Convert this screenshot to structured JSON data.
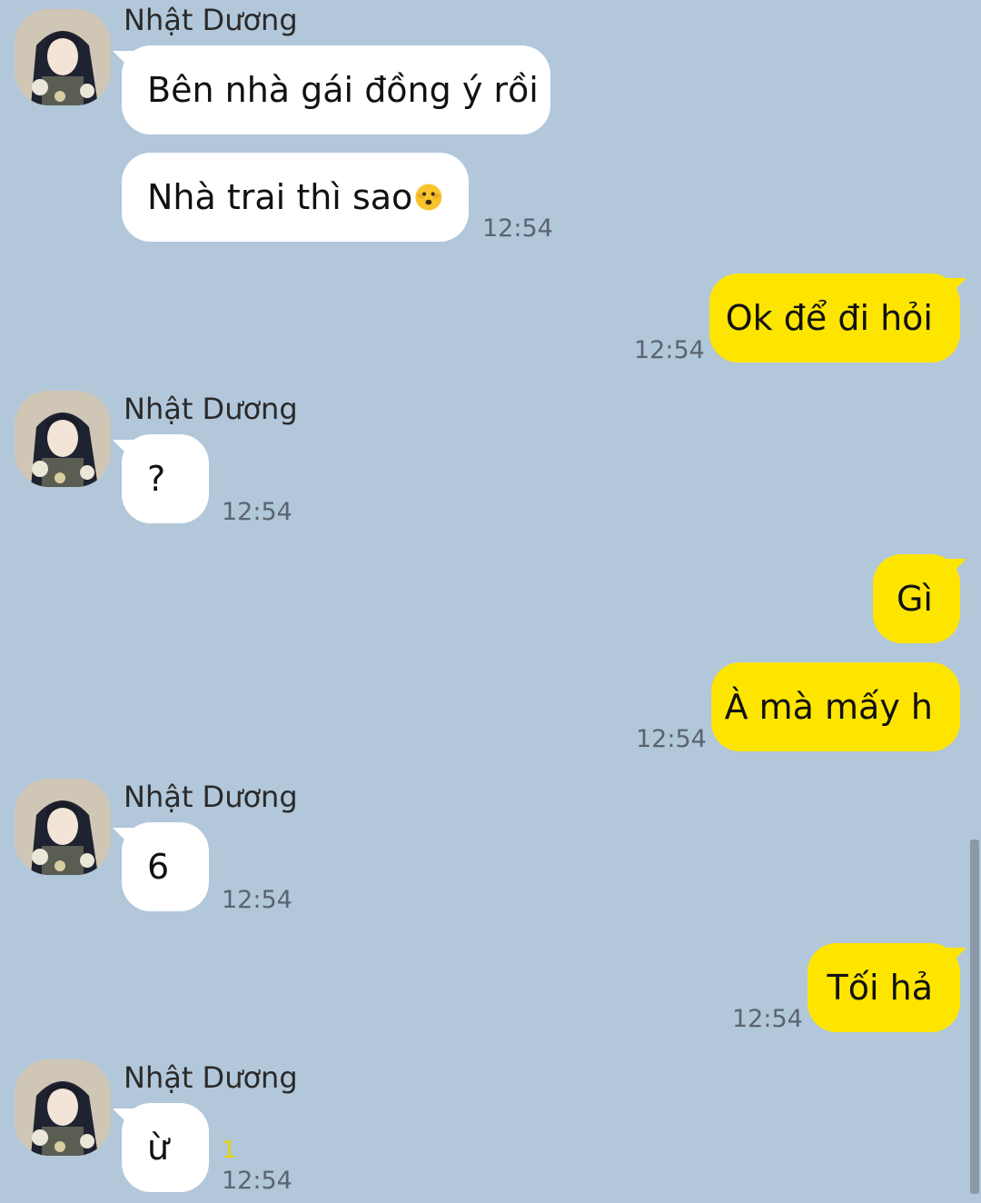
{
  "contact": {
    "name": "Nhật Dương"
  },
  "messages": [
    {
      "sender": "Nhật Dương",
      "text": "Bên nhà gái đồng ý rồi"
    },
    {
      "sender": "Nhật Dương",
      "text": "Nhà trai thì sao",
      "emoji": "face-with-open-eyes-and-hand-over-mouth-icon",
      "time": "12:54"
    },
    {
      "sender": "me",
      "text": "Ok để đi hỏi",
      "time": "12:54"
    },
    {
      "sender": "Nhật Dương",
      "text": "?",
      "time": "12:54"
    },
    {
      "sender": "me",
      "text": "Gì"
    },
    {
      "sender": "me",
      "text": "À mà mấy h",
      "time": "12:54"
    },
    {
      "sender": "Nhật Dương",
      "text": "6",
      "time": "12:54"
    },
    {
      "sender": "me",
      "text": "Tối hả",
      "time": "12:54"
    },
    {
      "sender": "Nhật Dương",
      "text": "ừ",
      "time": "12:54",
      "unread": "1"
    }
  ],
  "colors": {
    "background": "#b2c7da",
    "incoming_bubble": "#ffffff",
    "outgoing_bubble": "#fee500",
    "unread_count": "#e6d200"
  }
}
